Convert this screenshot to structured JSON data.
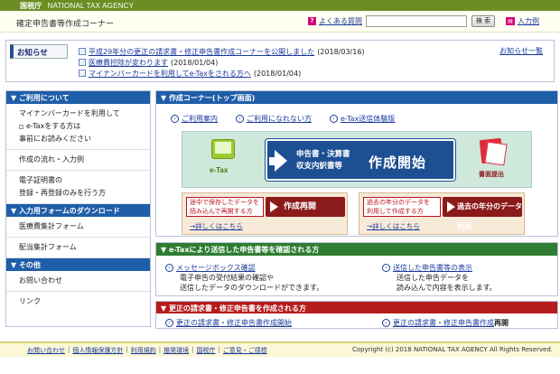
{
  "header": {
    "agency_jp": "国税庁",
    "agency_en": "NATIONAL TAX AGENCY",
    "app_title": "確定申告書等作成コーナー",
    "faq_label": "よくある質問",
    "search_placeholder": "",
    "search_button": "検 索",
    "enter_label": "入力例"
  },
  "notice": {
    "title": "お知らせ",
    "items": [
      {
        "text": "平成29年分の更正の請求書・修正申告書作成コーナーを公開しました",
        "date": "(2018/03/16)"
      },
      {
        "text": "医療費控除が変わります",
        "date": "(2018/01/04)"
      },
      {
        "text": "マイナンバーカードを利用してe-Taxをされる方へ",
        "date": "(2018/01/04)"
      }
    ],
    "all_link": "お知らせ一覧"
  },
  "sidebar": {
    "sections": [
      {
        "heading": "▼ ご利用について",
        "items": [
          {
            "lines": [
              "マイナンバーカードを利用して",
              "e-Taxをする方は",
              "事前にお読みください"
            ]
          },
          {
            "lines": [
              "作成の流れ・入力例"
            ]
          },
          {
            "lines": [
              "電子証明書の",
              "登録・再登録のみを行う方"
            ]
          }
        ]
      },
      {
        "heading": "▼ 入力用フォームのダウンロード",
        "items": [
          {
            "lines": [
              "医療費集計フォーム"
            ]
          },
          {
            "lines": [
              "配当集計フォーム"
            ]
          }
        ]
      },
      {
        "heading": "▼ その他",
        "items": [
          {
            "lines": [
              "お問い合わせ"
            ]
          },
          {
            "lines": [
              "リンク"
            ]
          }
        ]
      }
    ]
  },
  "main": {
    "heading": "▼ 作成コーナー(トップ画面)",
    "links": [
      "ご利用案内",
      "ご利用になれない方",
      "e-Tax送信体験版"
    ],
    "etax_label": "e-Tax",
    "start_small_1": "申告書・決算書",
    "start_small_2": "収支内訳書等",
    "start_big": "作成開始",
    "paper_label": "書面提出",
    "resume": {
      "desc_1": "途中で保存したデータを",
      "desc_2": "読み込んで再開する方",
      "button": "作成再開",
      "detail": "→詳しくはこちら"
    },
    "past": {
      "desc_1": "過去の年分のデータを",
      "desc_2": "利用して作成する方",
      "button": "過去の年分のデータ利用",
      "detail": "→詳しくはこちら"
    }
  },
  "etax_section": {
    "heading": "▼ e-Taxにより送信した申告書等を確認される方",
    "left_link": "メッセージボックス確認",
    "left_desc_1": "電子申告の受付結果の確認や",
    "left_desc_2": "送信したデータのダウンロードができます。",
    "right_link": "送信した申告書等の表示",
    "right_desc_1": "送信した申告データを",
    "right_desc_2": "読み込んで内容を表示します。"
  },
  "correction_section": {
    "heading": "▼ 更正の請求書・修正申告書を作成される方",
    "left_link": "更正の請求書・修正申告書作成開始",
    "right_link": "更正の請求書・修正申告書作成",
    "right_bold": "再開"
  },
  "footer": {
    "links": [
      "お問い合わせ",
      "個人情報保護方針",
      "利用規約",
      "推奨環境",
      "国税庁",
      "ご意見・ご感想"
    ],
    "copyright": "Copyright (c) 2018 NATIONAL TAX AGENCY All Rights Reserved."
  }
}
